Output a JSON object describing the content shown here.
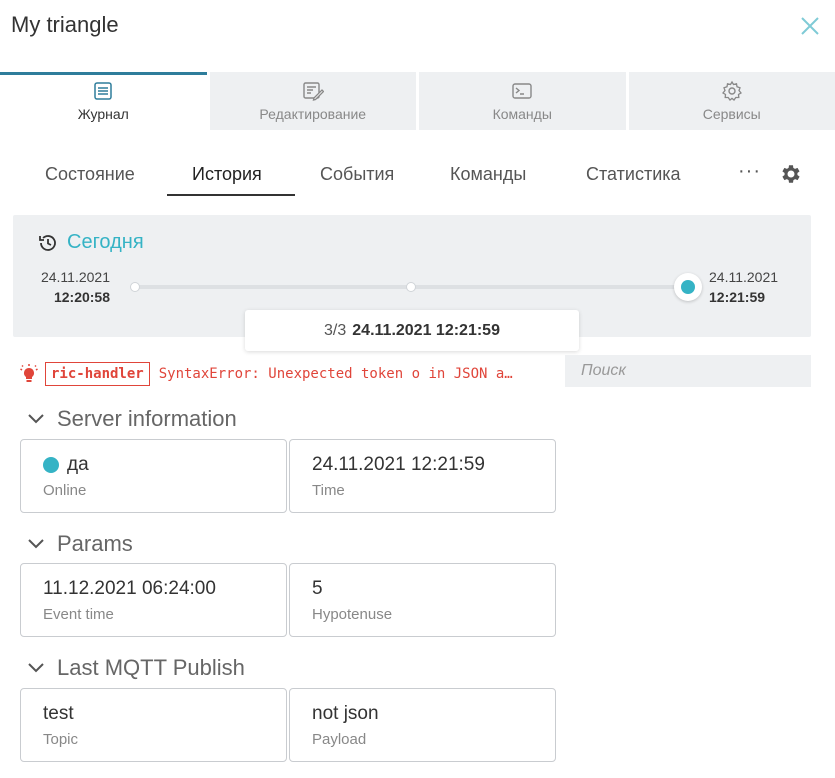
{
  "window": {
    "title": "My triangle"
  },
  "main_tabs": [
    {
      "label": "Журнал",
      "icon": "journal-icon",
      "active": true
    },
    {
      "label": "Редактирование",
      "icon": "edit-icon",
      "active": false
    },
    {
      "label": "Команды",
      "icon": "terminal-icon",
      "active": false
    },
    {
      "label": "Сервисы",
      "icon": "services-gear-icon",
      "active": false
    }
  ],
  "sub_tabs": [
    {
      "label": "Состояние"
    },
    {
      "label": "История",
      "active": true
    },
    {
      "label": "События"
    },
    {
      "label": "Команды"
    },
    {
      "label": "Статистика"
    }
  ],
  "more_label": "···",
  "timeline": {
    "period_label": "Сегодня",
    "start_date": "24.11.2021",
    "start_time": "12:20:58",
    "end_date": "24.11.2021",
    "end_time": "12:21:59",
    "position_label": "3/3",
    "position_time": "24.11.2021 12:21:59",
    "total_points": 3,
    "selected_point": 3
  },
  "error": {
    "handler": "ric-handler",
    "message": "SyntaxError: Unexpected token o in JSON a…"
  },
  "search": {
    "placeholder": "Поиск",
    "value": ""
  },
  "sections": [
    {
      "title": "Server information",
      "fields": [
        {
          "value": "да",
          "label": "Online",
          "status": true
        },
        {
          "value": "24.11.2021 12:21:59",
          "label": "Time"
        }
      ]
    },
    {
      "title": "Params",
      "fields": [
        {
          "value": "11.12.2021 06:24:00",
          "label": "Event time"
        },
        {
          "value": "5",
          "label": "Hypotenuse"
        }
      ]
    },
    {
      "title": "Last MQTT Publish",
      "fields": [
        {
          "value": "test",
          "label": "Topic"
        },
        {
          "value": "not json",
          "label": "Payload"
        }
      ]
    }
  ],
  "colors": {
    "accent": "#35b3c5",
    "active_tab_bar": "#2e7d9b",
    "error": "#e0453a",
    "panel_bg": "#eef0f2"
  }
}
